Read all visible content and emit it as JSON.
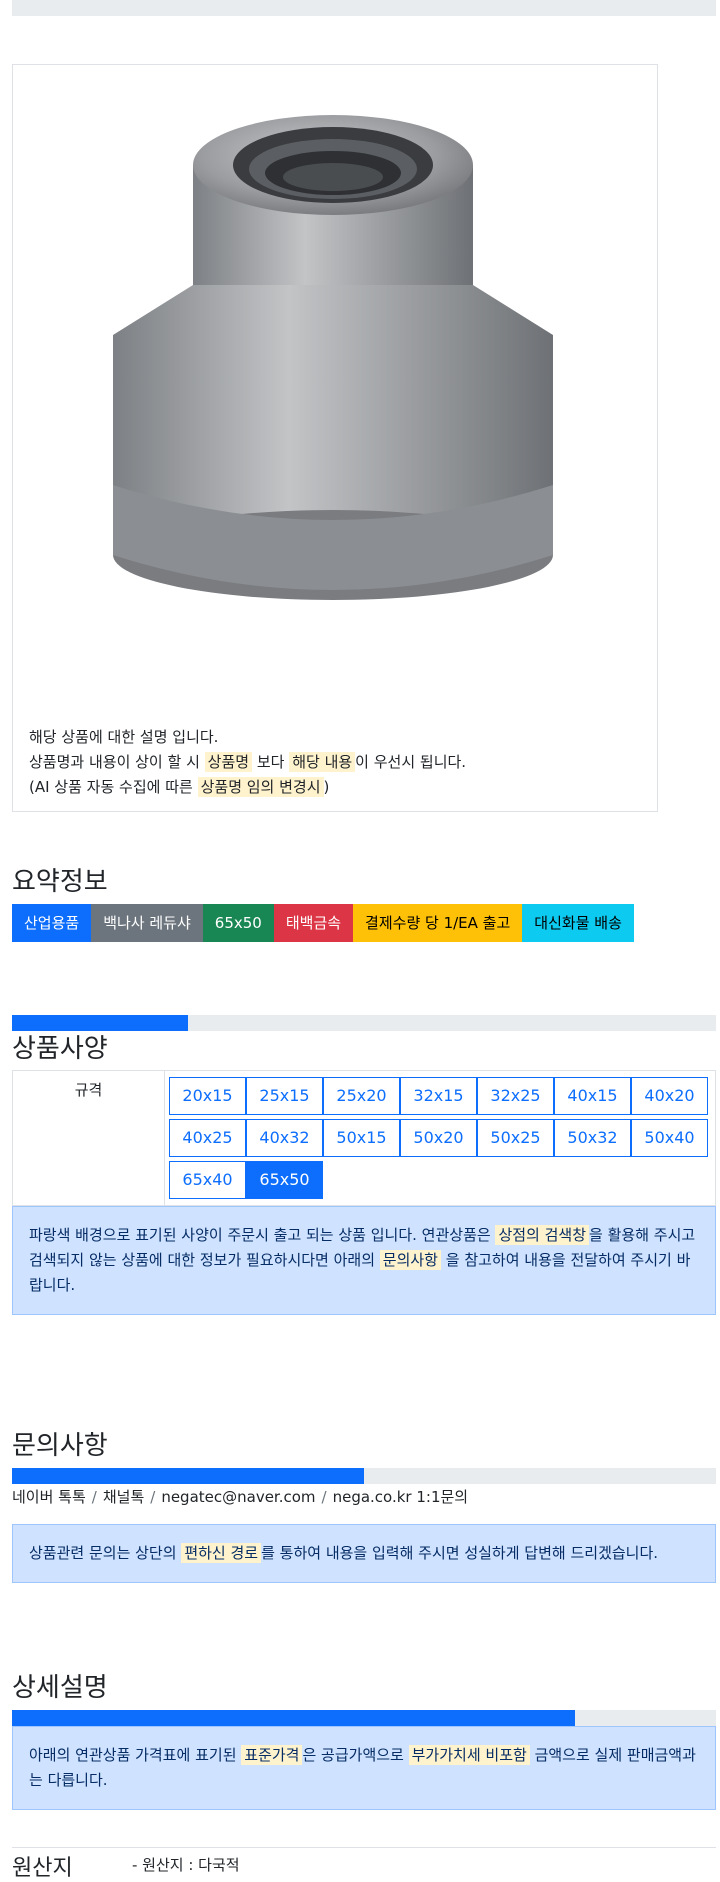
{
  "product": {
    "image_alt": "백나사 레듀샤 product photo",
    "description": {
      "line1": "해당 상품에 대한 설명 입니다.",
      "line2_pre": "상품명과 내용이 상이 할 시 ",
      "line2_hl1": "상품명",
      "line2_mid": " 보다 ",
      "line2_hl2": "해당 내용",
      "line2_post": "이 우선시 됩니다.",
      "line3_pre": "(AI 상품 자동 수집에 따른 ",
      "line3_hl": "상품명 임의 변경시",
      "line3_post": ")"
    }
  },
  "summary": {
    "title": "요약정보",
    "badges": [
      "산업용품",
      "백나사 레듀샤",
      "65x50",
      "태백금속",
      "결제수량 당 1/EA 출고",
      "대신화물 배송"
    ]
  },
  "spec": {
    "title": "상품사양",
    "progress": 0.25,
    "label": "규격",
    "sizes": [
      "20x15",
      "25x15",
      "25x20",
      "32x15",
      "32x25",
      "40x15",
      "40x20",
      "40x25",
      "40x32",
      "50x15",
      "50x20",
      "50x25",
      "50x32",
      "50x40",
      "65x40",
      "65x50"
    ],
    "selected": "65x50",
    "notice_pre": "파랑색 배경으로 표기된 사양이 주문시 출고 되는 상품 입니다. 연관상품은 ",
    "notice_hl1": "상점의 검색창",
    "notice_mid": "을 활용해 주시고 검색되지 않는 상품에 대한 정보가 필요하시다면 아래의 ",
    "notice_hl2": "문의사항",
    "notice_post": " 을 참고하여 내용을 전달하여 주시기 바랍니다."
  },
  "inquiry": {
    "title": "문의사항",
    "progress": 0.5,
    "channels": [
      "네이버 톡톡",
      "채널톡",
      "negatec@naver.com",
      "nega.co.kr 1:1문의"
    ],
    "notice_pre": "상품관련 문의는 상단의 ",
    "notice_hl": "편하신 경로",
    "notice_post": "를 통하여 내용을 입력해 주시면 성실하게 답변해 드리겠습니다."
  },
  "detail": {
    "title": "상세설명",
    "progress": 0.8,
    "notice_pre": "아래의 연관상품 가격표에 표기된 ",
    "notice_hl1": "표준가격",
    "notice_mid": "은 공급가액으로 ",
    "notice_hl2": "부가가치세 비포함",
    "notice_post": " 금액으로 실제 판매금액과는 다릅니다."
  },
  "origin": {
    "title": "원산지",
    "value": "- 원산지 : 다국적"
  },
  "colors": {
    "primary": "#0d6efd",
    "highlight": "#fff3cd",
    "alert_bg": "#cfe2ff"
  }
}
